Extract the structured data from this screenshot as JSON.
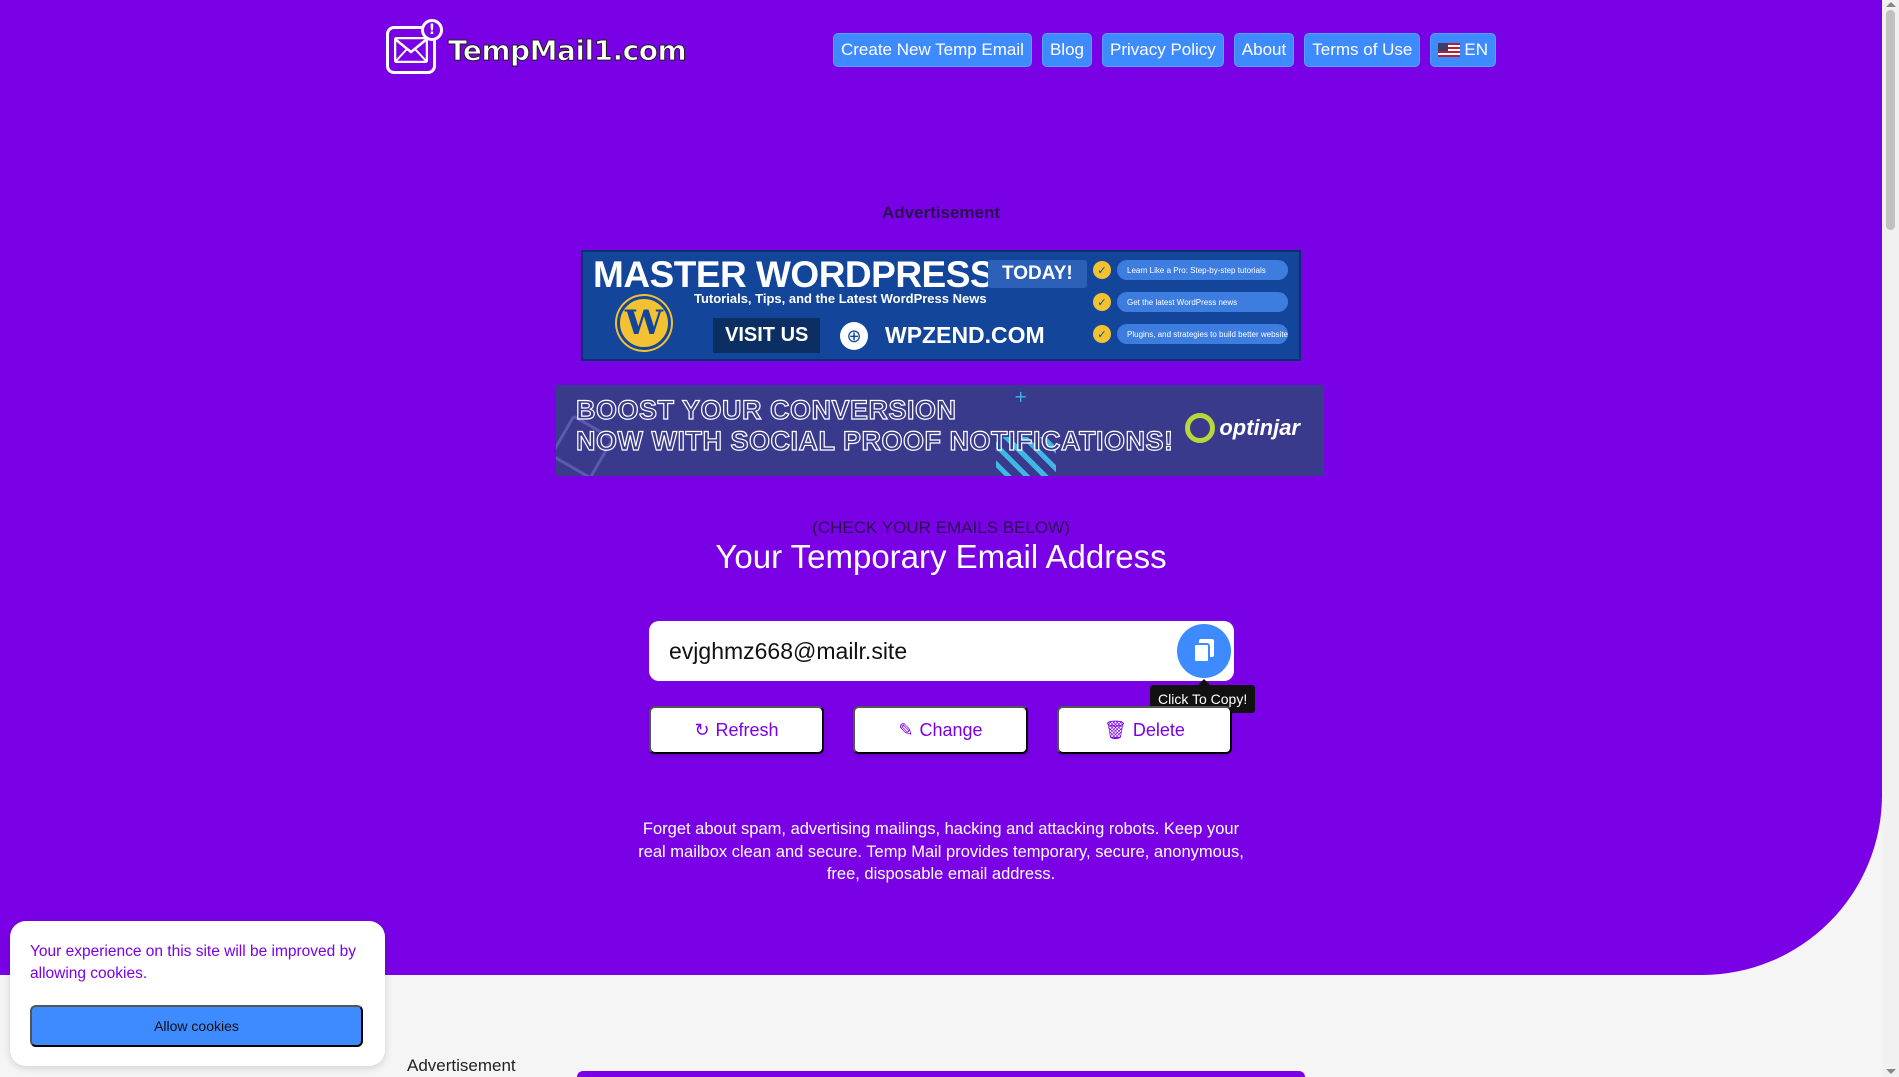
{
  "header": {
    "logo_text": "TempMail1.com",
    "nav": [
      {
        "label": "Create New Temp Email"
      },
      {
        "label": "Blog"
      },
      {
        "label": "Privacy Policy"
      },
      {
        "label": "About"
      },
      {
        "label": "Terms of Use"
      },
      {
        "label": "EN"
      }
    ]
  },
  "ads": {
    "top_label": "Advertisement",
    "banner1": {
      "title": "MASTER WORDPRESS",
      "today": "TODAY!",
      "subtitle": "Tutorials, Tips, and the Latest WordPress News",
      "visit": "VISIT US",
      "site": "WPZEND.COM",
      "items": [
        "Learn Like a Pro: Step-by-step tutorials",
        "Get the latest WordPress news",
        "Plugins, and strategies to build better websites"
      ]
    },
    "banner2": {
      "line1": "BOOST YOUR CONVERSION",
      "line2": "NOW WITH SOCIAL PROOF NOTIFICATIONS!",
      "brand": "optinjar"
    },
    "bottom_label": "Advertisement"
  },
  "email": {
    "check_label": "(CHECK YOUR EMAILS BELOW)",
    "title": "Your Temporary Email Address",
    "address": "evjghmz668@mailr.site",
    "copy_tooltip": "Click To Copy!",
    "actions": {
      "refresh": "Refresh",
      "change": "Change",
      "delete": "Delete"
    }
  },
  "description": "Forget about spam, advertising mailings, hacking and attacking robots. Keep your real mailbox clean and secure. Temp Mail provides temporary, secure, anonymous, free, disposable email address.",
  "cookie": {
    "text": "Your experience on this site will be improved by allowing cookies.",
    "button": "Allow cookies"
  },
  "colors": {
    "hero_bg": "#7a00e6",
    "accent_blue": "#3d8bff",
    "page_bg": "#f5f5f5"
  }
}
